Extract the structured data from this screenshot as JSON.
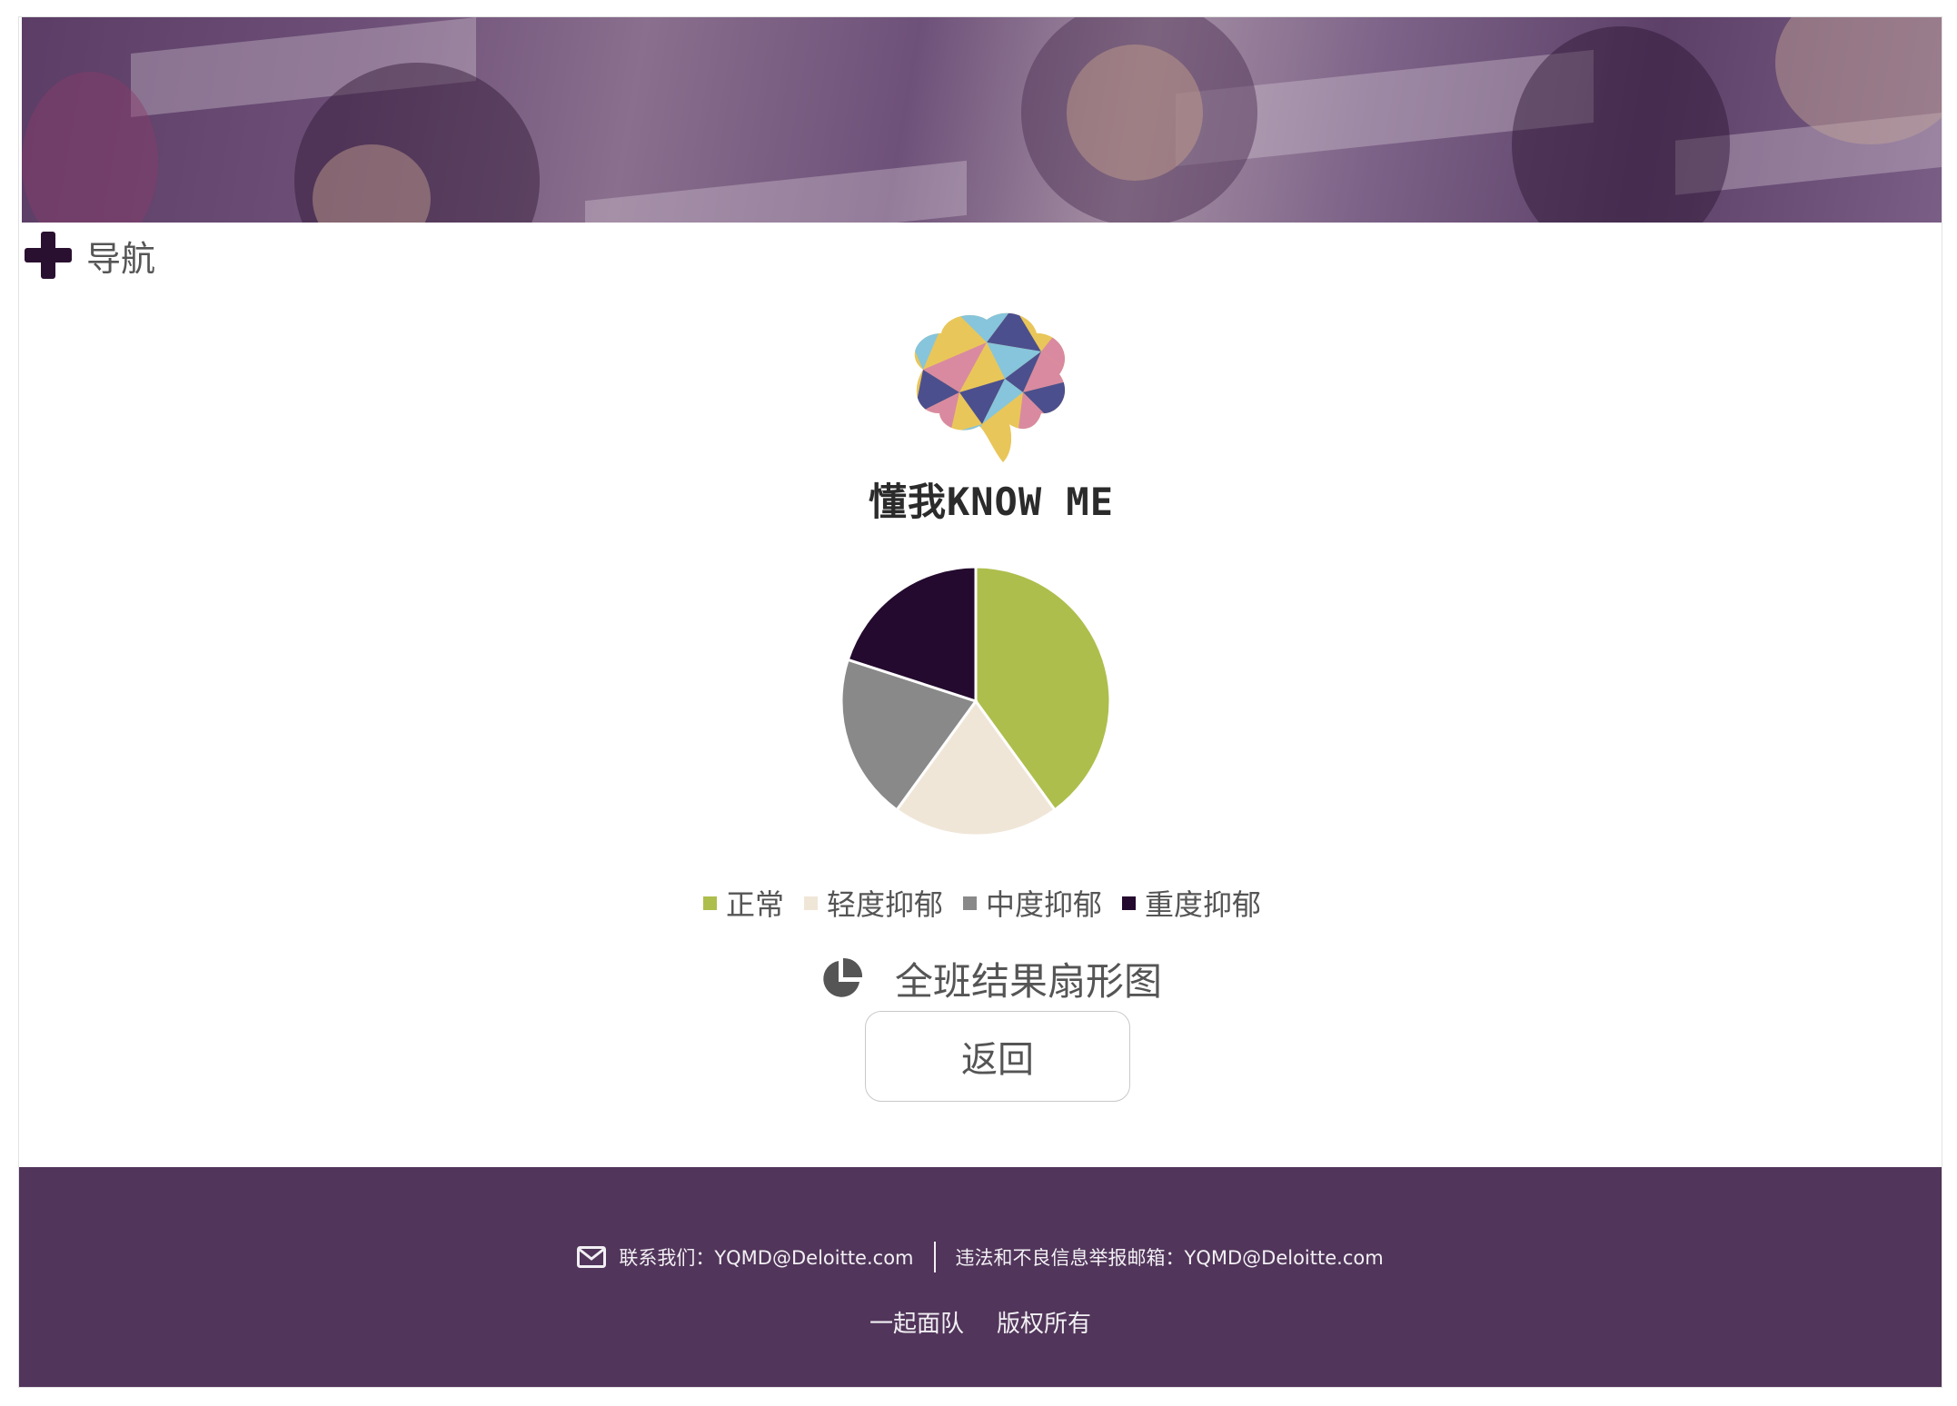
{
  "nav": {
    "label": "导航",
    "icon": "plus-icon"
  },
  "brand": {
    "name": "懂我KNOW ME"
  },
  "chart_data": {
    "type": "pie",
    "categories": [
      "正常",
      "轻度抑郁",
      "中度抑郁",
      "重度抑郁"
    ],
    "values": [
      40,
      20,
      20,
      20
    ],
    "colors": [
      "#aebe4c",
      "#f0e6d8",
      "#898989",
      "#240a2e"
    ],
    "title": "全班结果扇形图",
    "legend_position": "bottom"
  },
  "actions": {
    "back_label": "返回"
  },
  "footer": {
    "contact": "联系我们：YQMD@Deloitte.com",
    "report": "违法和不良信息举报邮箱：YQMD@Deloitte.com",
    "team": "一起面队",
    "copyright": "版权所有"
  },
  "colors": {
    "footer_bg": "#51355a",
    "accent": "#2a1030"
  }
}
